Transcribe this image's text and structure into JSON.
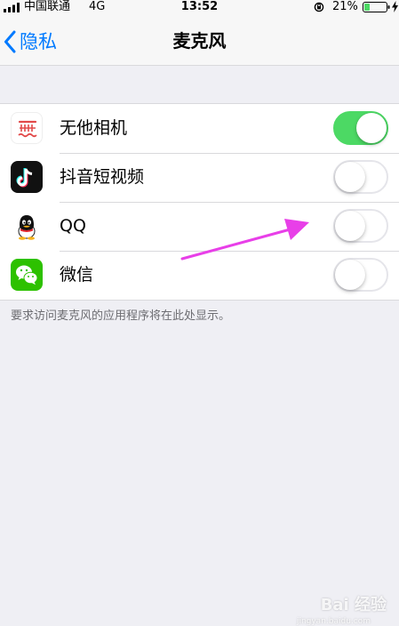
{
  "status_bar": {
    "carrier": "中国联通",
    "network": "4G",
    "time": "13:52",
    "battery_percent": "21%"
  },
  "nav": {
    "back_label": "隐私",
    "title": "麦克风"
  },
  "apps": [
    {
      "name": "无他相机",
      "icon": "wuta-camera-icon",
      "enabled": true
    },
    {
      "name": "抖音短视频",
      "icon": "douyin-icon",
      "enabled": false
    },
    {
      "name": "QQ",
      "icon": "qq-icon",
      "enabled": false
    },
    {
      "name": "微信",
      "icon": "wechat-icon",
      "enabled": false
    }
  ],
  "footer_note": "要求访问麦克风的应用程序将在此处显示。",
  "watermark": {
    "text": "Bai 经验",
    "sub": "jingyan.baidu.com"
  },
  "colors": {
    "accent": "#007aff",
    "toggle_on": "#4cd964",
    "annotation": "#e83fe8"
  }
}
